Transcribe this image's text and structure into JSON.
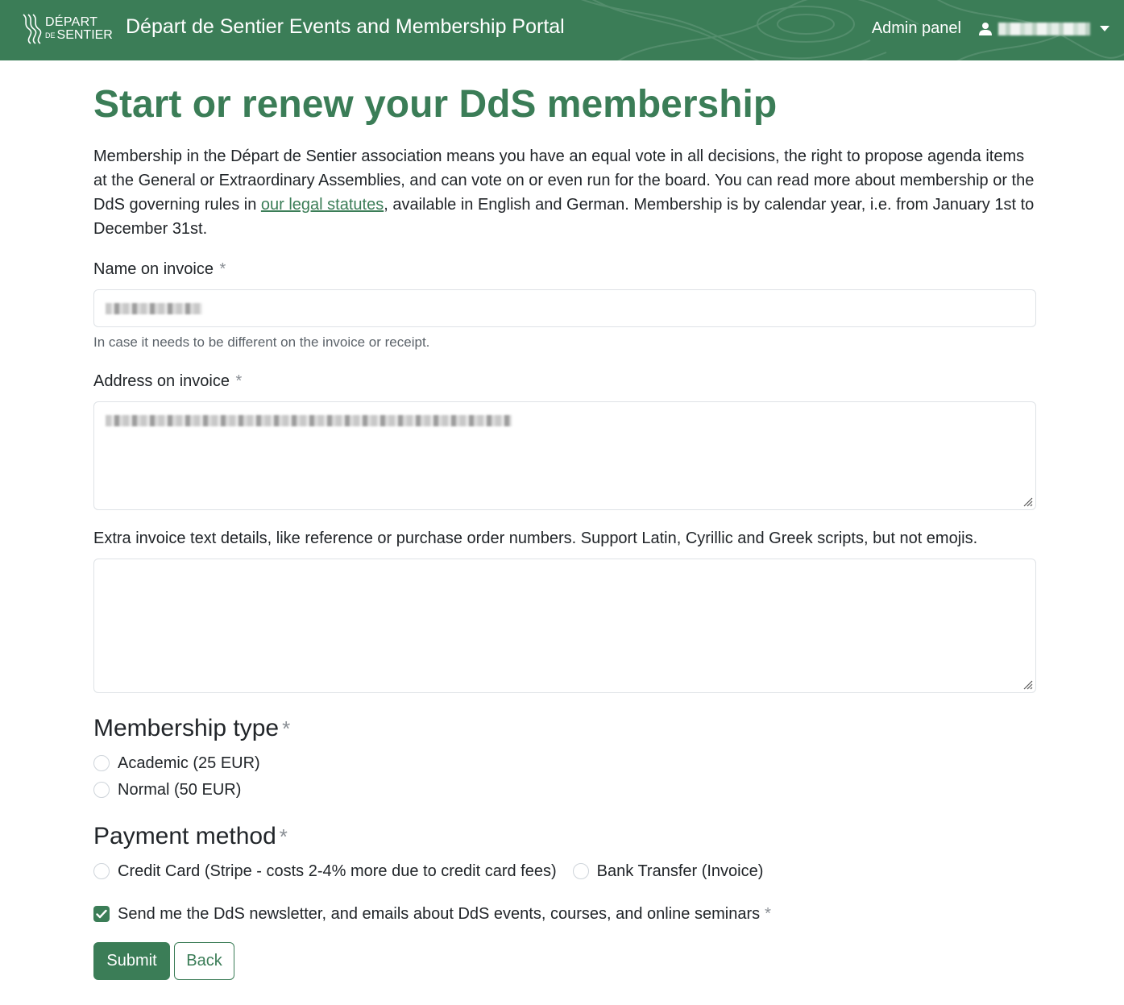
{
  "navbar": {
    "logo_line1": "DÉPART",
    "logo_de": "DE",
    "logo_line2": "SENTIER",
    "title": "Départ de Sentier Events and Membership Portal",
    "admin_link": "Admin panel"
  },
  "page": {
    "heading": "Start or renew your DdS membership",
    "intro_before": "Membership in the Départ de Sentier association means you have an equal vote in all decisions, the right to propose agenda items at the General or Extraordinary Assemblies, and can vote on or even run for the board. You can read more about membership or the DdS governing rules in ",
    "intro_link": "our legal statutes",
    "intro_after": ", available in English and German. Membership is by calendar year, i.e. from January 1st to December 31st."
  },
  "form": {
    "required_mark": "*",
    "name": {
      "label": "Name on invoice",
      "help": "In case it needs to be different on the invoice or receipt."
    },
    "address": {
      "label": "Address on invoice"
    },
    "extra": {
      "label": "Extra invoice text details, like reference or purchase order numbers. Support Latin, Cyrillic and Greek scripts, but not emojis."
    },
    "membership_type": {
      "title": "Membership type",
      "options": [
        "Academic (25 EUR)",
        "Normal (50 EUR)"
      ]
    },
    "payment_method": {
      "title": "Payment method",
      "options": [
        "Credit Card (Stripe - costs 2-4% more due to credit card fees)",
        "Bank Transfer (Invoice)"
      ]
    },
    "newsletter": {
      "label": "Send me the DdS newsletter, and emails about DdS events, courses, and online seminars",
      "checked": true
    },
    "submit_label": "Submit",
    "back_label": "Back"
  },
  "colors": {
    "brand_green": "#3b7d57",
    "border": "#dee2e6"
  },
  "icons": [
    "dds-logo-icon",
    "user-icon",
    "caret-down-icon",
    "check-icon",
    "resize-grip-icon"
  ]
}
